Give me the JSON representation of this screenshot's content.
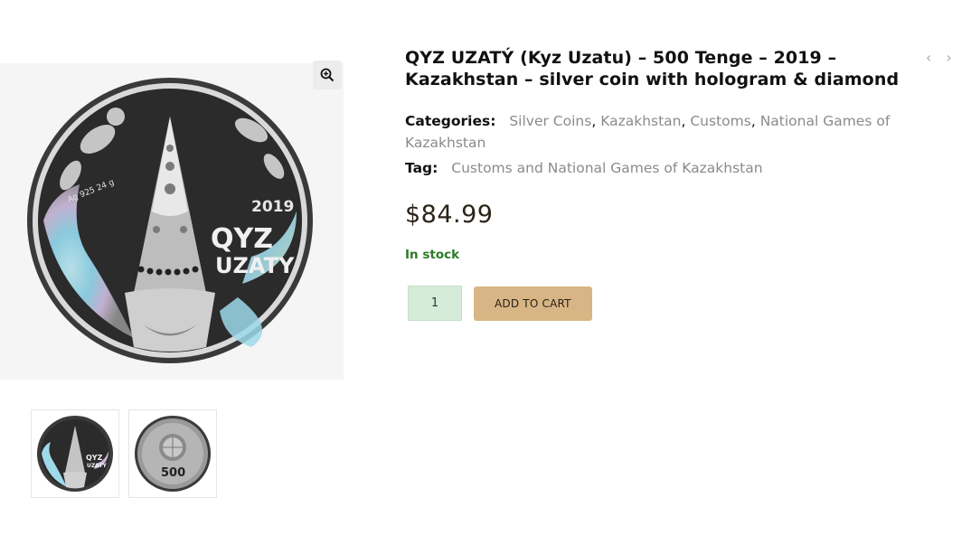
{
  "product": {
    "title": "QYZ UZATÝ (Kyz Uzatu) – 500 Tenge – 2019 – Kazakhstan – silver coin with hologram & diamond",
    "categories_label": "Categories:",
    "categories": [
      "Silver Coins",
      "Kazakhstan",
      "Customs",
      "National Games of Kazakhstan"
    ],
    "tag_label": "Tag:",
    "tag": "Customs and National Games of Kazakhstan",
    "price": "$84.99",
    "stock": "In stock",
    "quantity": "1",
    "add_to_cart_label": "ADD TO CART"
  },
  "gallery": {
    "main_coin_text": [
      "2019",
      "QYZ",
      "UZATY",
      "Ag 925 24 g"
    ],
    "thumb2_text": "500",
    "zoom_icon": "magnifier-plus-icon"
  },
  "nav": {
    "prev_icon": "‹",
    "next_icon": "›"
  },
  "colors": {
    "add_to_cart_bg": "#d8b584",
    "qty_bg": "#d4ecd8",
    "stock": "#2a7a2a",
    "meta_link": "#8b8b8b"
  }
}
